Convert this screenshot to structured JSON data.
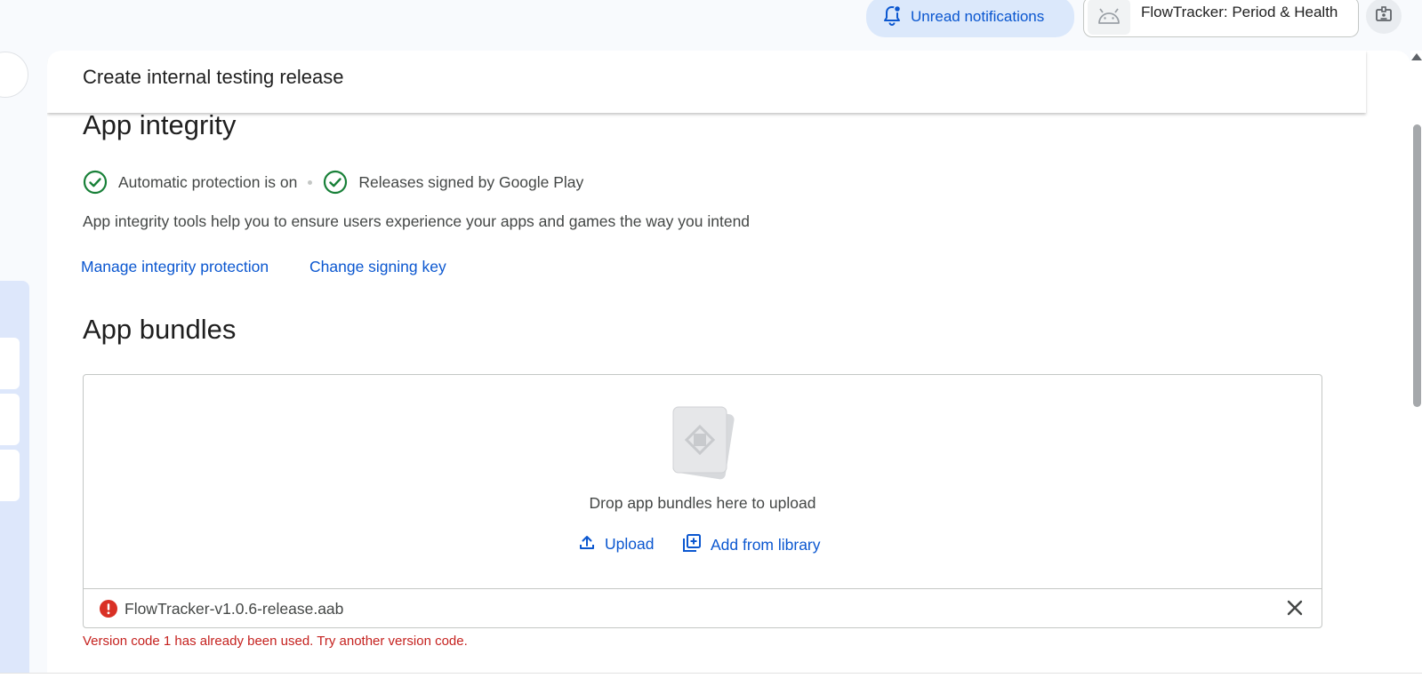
{
  "topbar": {
    "notifications_label": "Unread notifications",
    "app_name": "FlowTracker: Period & Health"
  },
  "page": {
    "title": "Create internal testing release"
  },
  "app_integrity": {
    "heading": "App integrity",
    "status_1": "Automatic protection is on",
    "status_2": "Releases signed by Google Play",
    "description": "App integrity tools help you to ensure users experience your apps and games the way you intend",
    "link_manage": "Manage integrity protection",
    "link_change_key": "Change signing key"
  },
  "app_bundles": {
    "heading": "App bundles",
    "drop_text": "Drop app bundles here to upload",
    "upload_label": "Upload",
    "library_label": "Add from library",
    "file_name": "FlowTracker-v1.0.6-release.aab",
    "error_message": "Version code 1 has already been used. Try another version code."
  },
  "colors": {
    "link_blue": "#0b57d0",
    "success_green": "#188038",
    "error_red": "#c5221f",
    "chip_bg": "#dbe8fb"
  },
  "icons": {
    "notifications": "bell-icon",
    "app": "android-icon",
    "account": "badge-icon",
    "status": "check-circle-icon",
    "upload": "upload-icon",
    "library": "library-add-icon",
    "error": "error-icon",
    "close": "close-icon"
  }
}
